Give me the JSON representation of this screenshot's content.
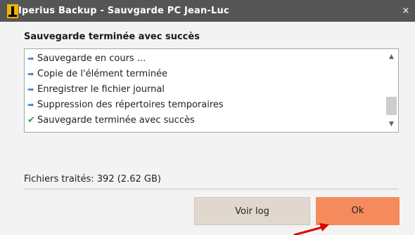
{
  "window": {
    "title": "Iperius Backup  -  Sauvgarde PC Jean-Luc",
    "close_label": "×",
    "accent_color": "#555555"
  },
  "heading": "Sauvegarde terminée avec succès",
  "log": {
    "items": [
      {
        "icon": "arrow-right-icon",
        "text": "Sauvegarde en cours ..."
      },
      {
        "icon": "arrow-right-icon",
        "text": "Copie de l'élément terminée"
      },
      {
        "icon": "arrow-right-icon",
        "text": "Enregistrer le fichier journal"
      },
      {
        "icon": "arrow-right-icon",
        "text": "Suppression des répertoires temporaires"
      },
      {
        "icon": "check-icon",
        "text": "Sauvegarde terminée avec succès"
      }
    ]
  },
  "status": "Fichiers traités: 392 (2.62 GB)",
  "buttons": {
    "log_label": "Voir log",
    "ok_label": "Ok",
    "ok_color": "#f58b5c",
    "log_color": "#e0d7cf"
  },
  "annotation": {
    "color": "#e00000"
  }
}
